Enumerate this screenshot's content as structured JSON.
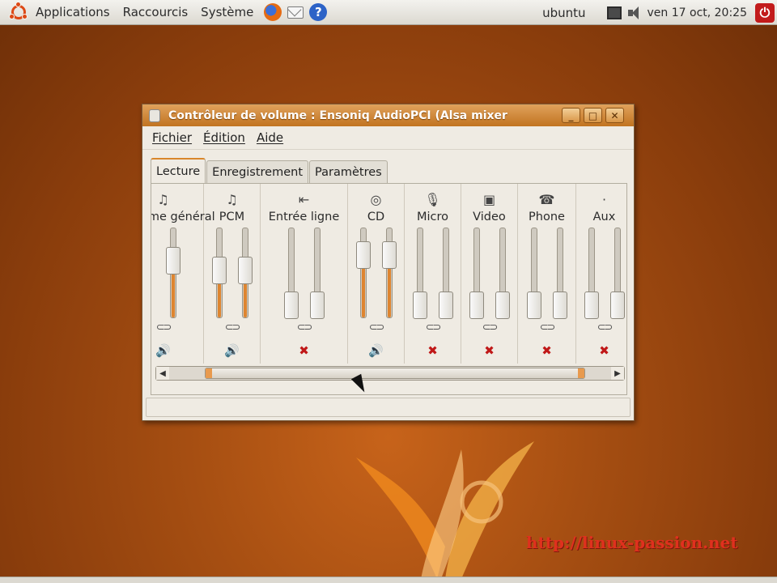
{
  "top_panel": {
    "menus": [
      "Applications",
      "Raccourcis",
      "Système"
    ],
    "user": "ubuntu",
    "clock": "ven 17 oct, 20:25"
  },
  "window": {
    "title": "Contrôleur de volume : Ensoniq AudioPCI (Alsa mixer",
    "menu": [
      "Fichier",
      "Édition",
      "Aide"
    ],
    "tabs": [
      {
        "label": "Lecture",
        "active": true
      },
      {
        "label": "Enregistrement",
        "active": false
      },
      {
        "label": "Paramètres",
        "active": false
      }
    ],
    "channels": [
      {
        "name": "Volume général",
        "icon": "music-note-icon",
        "levels": [
          0.7
        ],
        "muted": false
      },
      {
        "name": "PCM",
        "icon": "music-note-icon",
        "levels": [
          0.55,
          0.55
        ],
        "muted": false
      },
      {
        "name": "Entrée ligne",
        "icon": "line-in-icon",
        "levels": [
          0.0,
          0.0
        ],
        "muted": true
      },
      {
        "name": "CD",
        "icon": "cd-icon",
        "levels": [
          0.8,
          0.8
        ],
        "muted": false
      },
      {
        "name": "Micro",
        "icon": "microphone-icon",
        "levels": [
          0.0,
          0.0
        ],
        "muted": true
      },
      {
        "name": "Video",
        "icon": "video-icon",
        "levels": [
          0.0,
          0.0
        ],
        "muted": true
      },
      {
        "name": "Phone",
        "icon": "phone-icon",
        "levels": [
          0.0,
          0.0
        ],
        "muted": true
      },
      {
        "name": "Aux",
        "icon": "aux-icon",
        "levels": [
          0.0,
          0.0
        ],
        "muted": true
      }
    ]
  },
  "watermark": "http://linux-passion.net",
  "colors": {
    "accent": "#de8530",
    "titlebar": "#c17320",
    "mute": "#c01818"
  }
}
